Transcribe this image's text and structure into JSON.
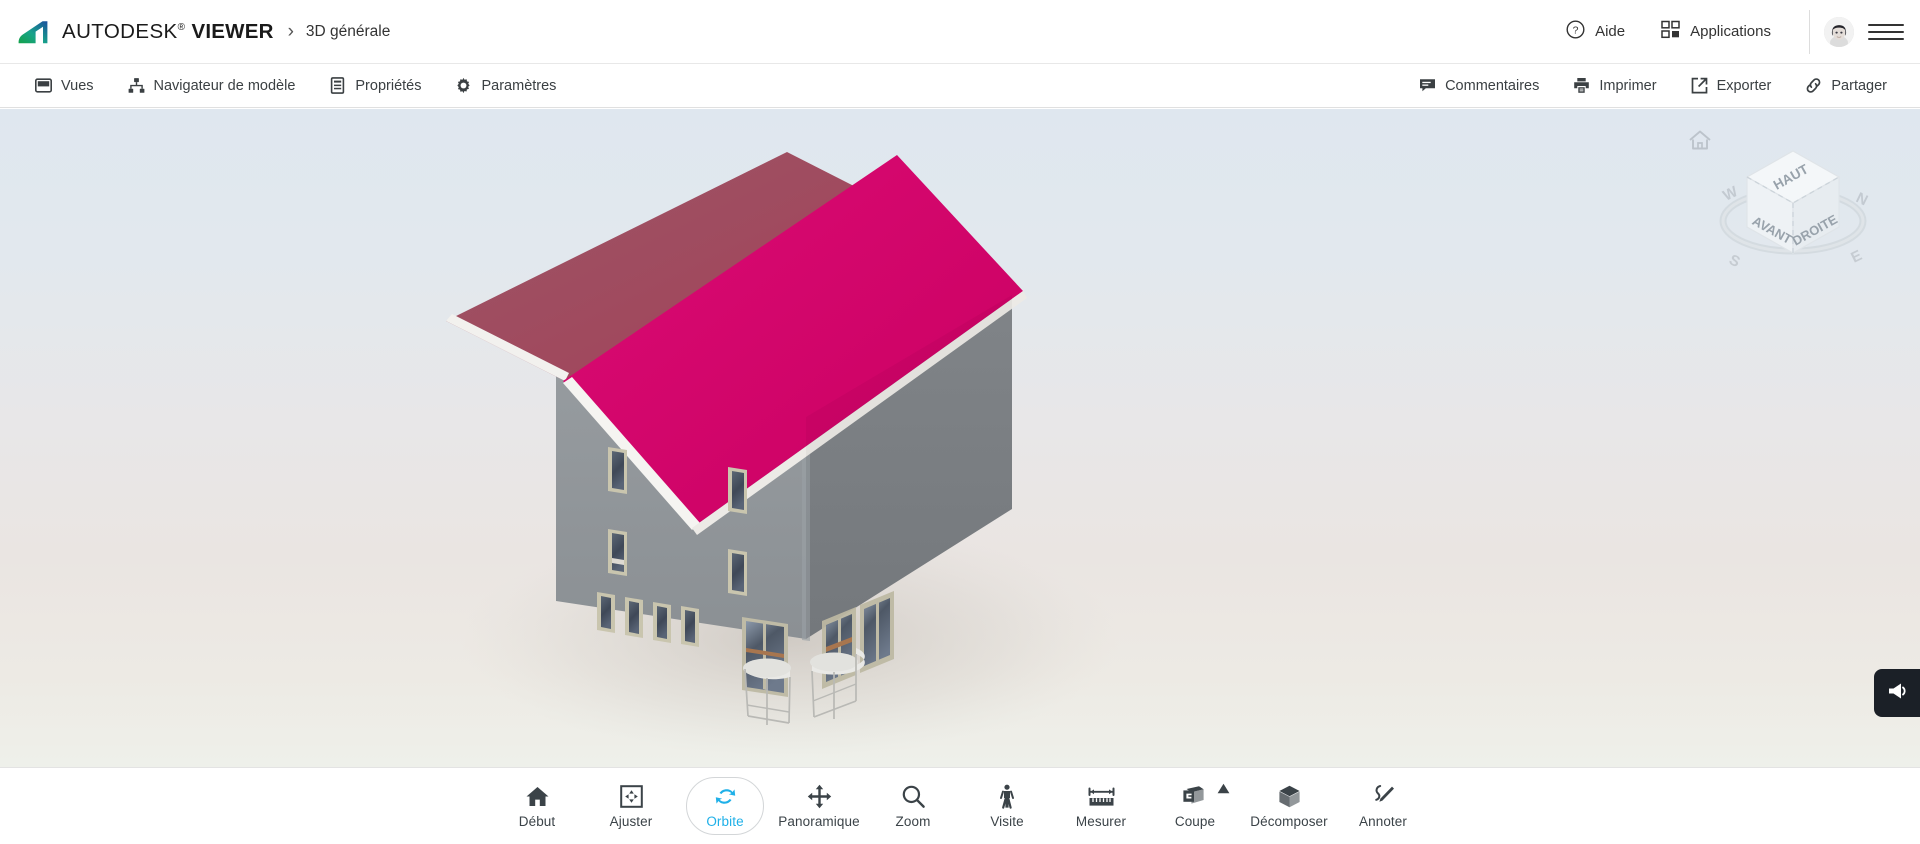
{
  "header": {
    "logo_icon": "autodesk-logo",
    "brand_prefix": "AUTODESK",
    "brand_sup": "®",
    "brand_suffix": "VIEWER",
    "breadcrumb_separator": "›",
    "document_title": "3D générale",
    "help": {
      "label": "Aide",
      "icon": "help-circle-icon"
    },
    "apps": {
      "label": "Applications",
      "icon": "grid-apps-icon"
    },
    "avatar_name": "user-avatar",
    "menu_icon": "hamburger-menu-icon"
  },
  "subtoolbar": {
    "left_items": [
      {
        "label": "Vues",
        "icon": "views-panel-icon"
      },
      {
        "label": "Navigateur de modèle",
        "icon": "model-tree-icon"
      },
      {
        "label": "Propriétés",
        "icon": "properties-document-icon"
      },
      {
        "label": "Paramètres",
        "icon": "gear-icon"
      }
    ],
    "right_items": [
      {
        "label": "Commentaires",
        "icon": "comment-bubble-icon"
      },
      {
        "label": "Imprimer",
        "icon": "printer-icon"
      },
      {
        "label": "Exporter",
        "icon": "export-external-link-icon"
      },
      {
        "label": "Partager",
        "icon": "share-link-icon"
      }
    ]
  },
  "viewport": {
    "home_icon": "home-view-icon",
    "viewcube": {
      "name": "view-cube",
      "face_top": "HAUT",
      "face_front": "AVANT",
      "face_right": "DROITE",
      "compass": {
        "n": "N",
        "e": "E",
        "s": "S",
        "w": "W"
      }
    },
    "model": {
      "name": "3d-building-model",
      "description": "Bâtiment 3D — toit sélectionné",
      "colors": {
        "selected_roof": "#d4006a",
        "roof": "#9c4e63",
        "wall_light": "#8d9195",
        "wall_dark": "#7d8185",
        "fascia": "#f0f0ee"
      }
    },
    "feedback_icon": "megaphone-feedback-icon"
  },
  "bottom_toolbar": {
    "active_tool": "Orbite",
    "accent_color": "#1fb0e8",
    "tools": [
      {
        "label": "Début",
        "icon": "home-icon",
        "active": false,
        "has_caret": false
      },
      {
        "label": "Ajuster",
        "icon": "fit-to-view-icon",
        "active": false,
        "has_caret": false
      },
      {
        "label": "Orbite",
        "icon": "orbit-icon",
        "active": true,
        "has_caret": false
      },
      {
        "label": "Panoramique",
        "icon": "pan-arrows-icon",
        "active": false,
        "has_caret": false
      },
      {
        "label": "Zoom",
        "icon": "magnifier-icon",
        "active": false,
        "has_caret": false
      },
      {
        "label": "Visite",
        "icon": "walk-person-icon",
        "active": false,
        "has_caret": false
      },
      {
        "label": "Mesurer",
        "icon": "ruler-measure-icon",
        "active": false,
        "has_caret": false
      },
      {
        "label": "Coupe",
        "icon": "section-cut-icon",
        "active": false,
        "has_caret": true
      },
      {
        "label": "Décomposer",
        "icon": "explode-cube-icon",
        "active": false,
        "has_caret": false
      },
      {
        "label": "Annoter",
        "icon": "annotate-pencil-icon",
        "active": false,
        "has_caret": false
      }
    ]
  }
}
